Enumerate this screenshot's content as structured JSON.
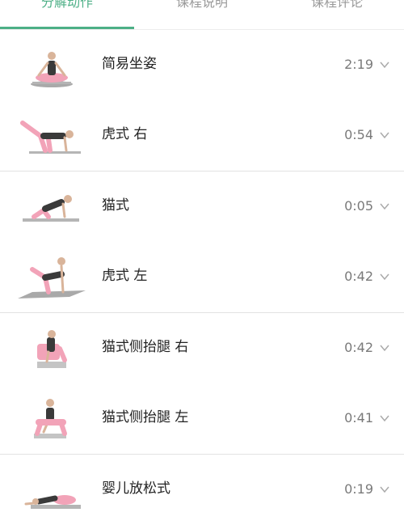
{
  "tabs": [
    {
      "label": "分解动作",
      "active": true
    },
    {
      "label": "课程说明",
      "active": false
    },
    {
      "label": "课程评论",
      "active": false
    }
  ],
  "colors": {
    "accent": "#4caf86",
    "mat": "#9a9a9a",
    "pants": "#f2a3b8",
    "top": "#3a3a3a",
    "skin": "#d9b49a"
  },
  "exercises": [
    {
      "name": "简易坐姿",
      "duration": "2:19",
      "pose": "seated"
    },
    {
      "name": "虎式 右",
      "duration": "0:54",
      "pose": "tiger-right"
    },
    {
      "name": "猫式",
      "duration": "0:05",
      "pose": "cat"
    },
    {
      "name": "虎式 左",
      "duration": "0:42",
      "pose": "tiger-left"
    },
    {
      "name": "猫式侧抬腿 右",
      "duration": "0:42",
      "pose": "side-leg"
    },
    {
      "name": "猫式侧抬腿 左",
      "duration": "0:41",
      "pose": "side-leg-front"
    },
    {
      "name": "婴儿放松式",
      "duration": "0:19",
      "pose": "child"
    }
  ]
}
